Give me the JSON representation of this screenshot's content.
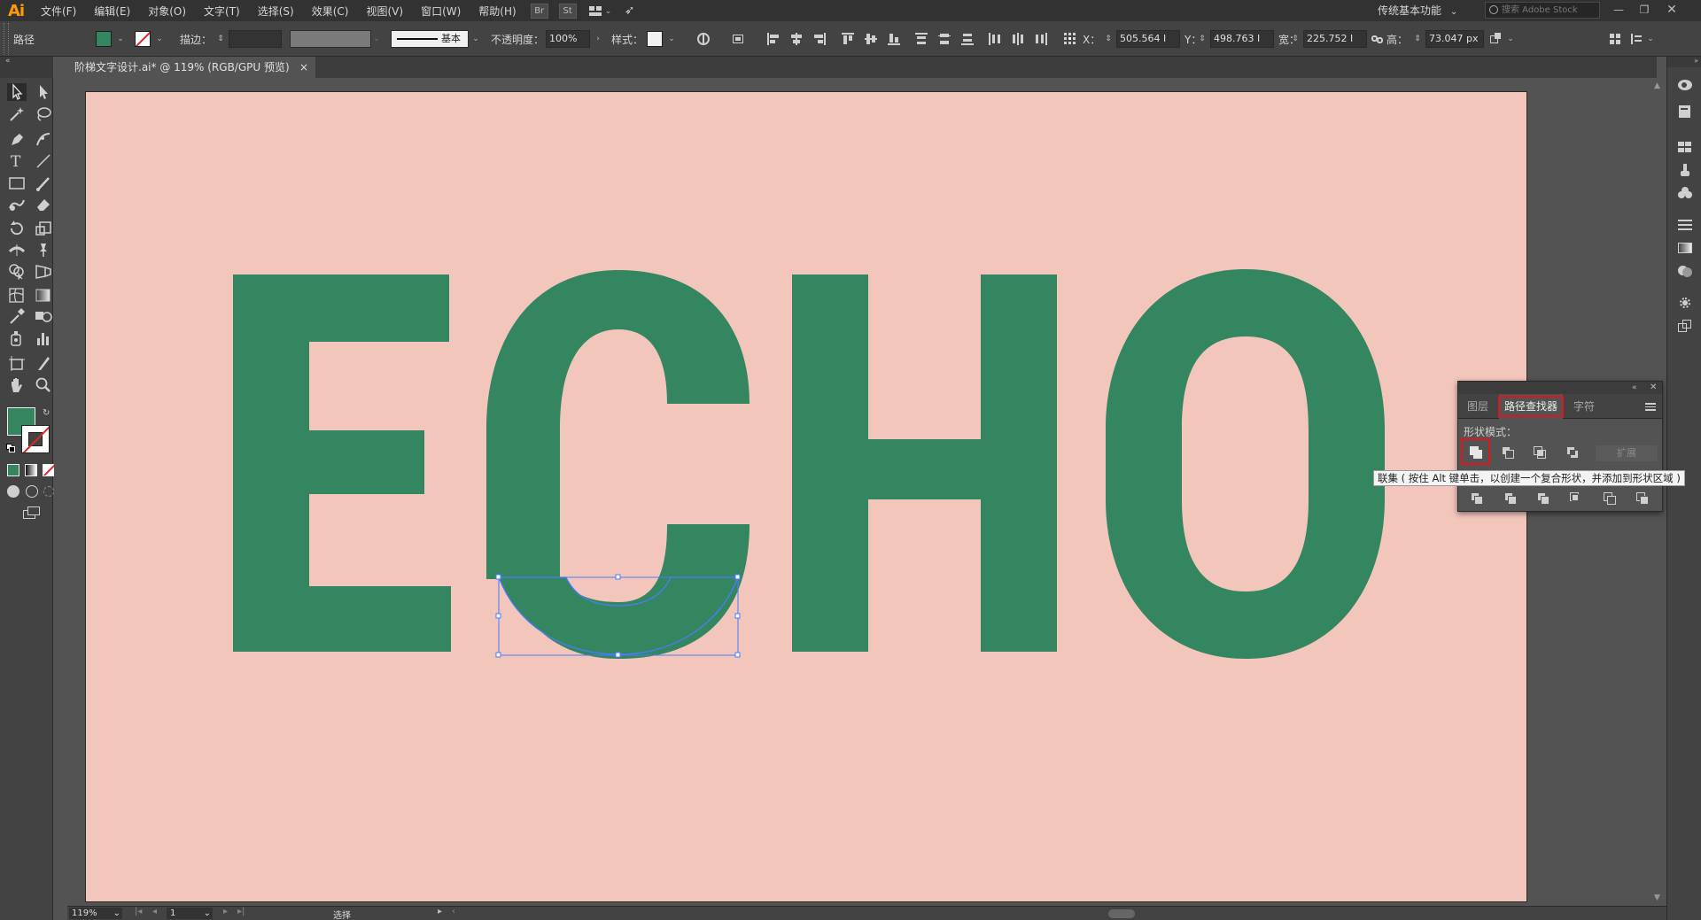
{
  "app": {
    "logo": "Ai"
  },
  "menu": [
    "文件(F)",
    "编辑(E)",
    "对象(O)",
    "文字(T)",
    "选择(S)",
    "效果(C)",
    "视图(V)",
    "窗口(W)",
    "帮助(H)"
  ],
  "menu_buttons": {
    "bridge": "Br",
    "stock": "St"
  },
  "workspace": "传统基本功能",
  "stock_search_placeholder": "搜索 Adobe Stock",
  "control": {
    "object_type": "路径",
    "stroke_label": "描边：",
    "stroke_style": "基本",
    "opacity_label": "不透明度：",
    "opacity_value": "100%",
    "style_label": "样式：",
    "x_label": "X：",
    "x_value": "505.564 I",
    "y_label": "Y：",
    "y_value": "498.763 I",
    "w_label": "宽：",
    "w_value": "225.752 I",
    "h_label": "高：",
    "h_value": "73.047 px"
  },
  "document_tab": {
    "title": "阶梯文字设计.ai* @ 119% (RGB/GPU 预览)",
    "close": "×"
  },
  "colors": {
    "fill": "#348660",
    "artboard": "#f3c6bc",
    "letters": "#348660",
    "selection": "#4a7bff",
    "highlight": "#e2141c"
  },
  "artwork": {
    "text": "ECHO"
  },
  "pathfinder": {
    "tabs": [
      "图层",
      "路径查找器",
      "字符"
    ],
    "active_tab": 1,
    "shape_modes_label": "形状模式：",
    "expand_label": "扩展",
    "tooltip": "联集 ( 按住 Alt 键单击，以创建一个复合形状，并添加到形状区域 )"
  },
  "status": {
    "zoom": "119%",
    "artboard_number": "1",
    "tool": "选择"
  }
}
